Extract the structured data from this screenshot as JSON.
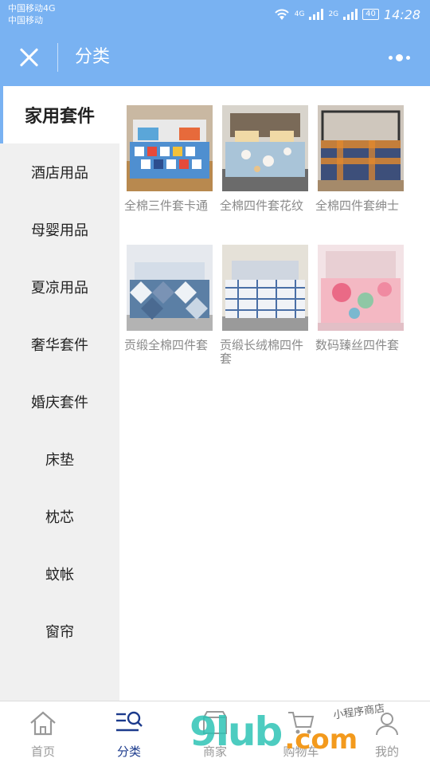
{
  "status_bar": {
    "carrier_line1": "中国移动4G",
    "carrier_line2": "中国移动",
    "net1": "4G",
    "net2": "2G",
    "battery": "40",
    "time": "14:28"
  },
  "header": {
    "title": "分类",
    "close_icon": "close-icon",
    "more_icon": "more-icon"
  },
  "sidebar": {
    "items": [
      {
        "label": "家用套件",
        "active": true
      },
      {
        "label": "酒店用品"
      },
      {
        "label": "母婴用品"
      },
      {
        "label": "夏凉用品"
      },
      {
        "label": "奢华套件"
      },
      {
        "label": "婚庆套件"
      },
      {
        "label": "床垫"
      },
      {
        "label": "枕芯"
      },
      {
        "label": "蚊帐"
      },
      {
        "label": "窗帘"
      }
    ]
  },
  "products": [
    {
      "name": "全棉三件套卡通"
    },
    {
      "name": "全棉四件套花纹"
    },
    {
      "name": "全棉四件套绅士"
    },
    {
      "name": "贡缎全棉四件套"
    },
    {
      "name": "贡缎长绒棉四件套"
    },
    {
      "name": "数码臻丝四件套"
    }
  ],
  "tabbar": {
    "tabs": [
      {
        "label": "首页",
        "icon": "home-icon"
      },
      {
        "label": "分类",
        "icon": "category-icon",
        "active": true
      },
      {
        "label": "商家",
        "icon": "shop-icon"
      },
      {
        "label": "购物车",
        "icon": "cart-icon"
      },
      {
        "label": "我的",
        "icon": "user-icon"
      }
    ]
  },
  "watermark": {
    "big": "9lub",
    "com": ".com",
    "small": "小程序商店"
  },
  "colors": {
    "brand": "#79b2f2",
    "tab_active": "#1b3a8c",
    "sidebar_bg": "#f0f0f0"
  }
}
